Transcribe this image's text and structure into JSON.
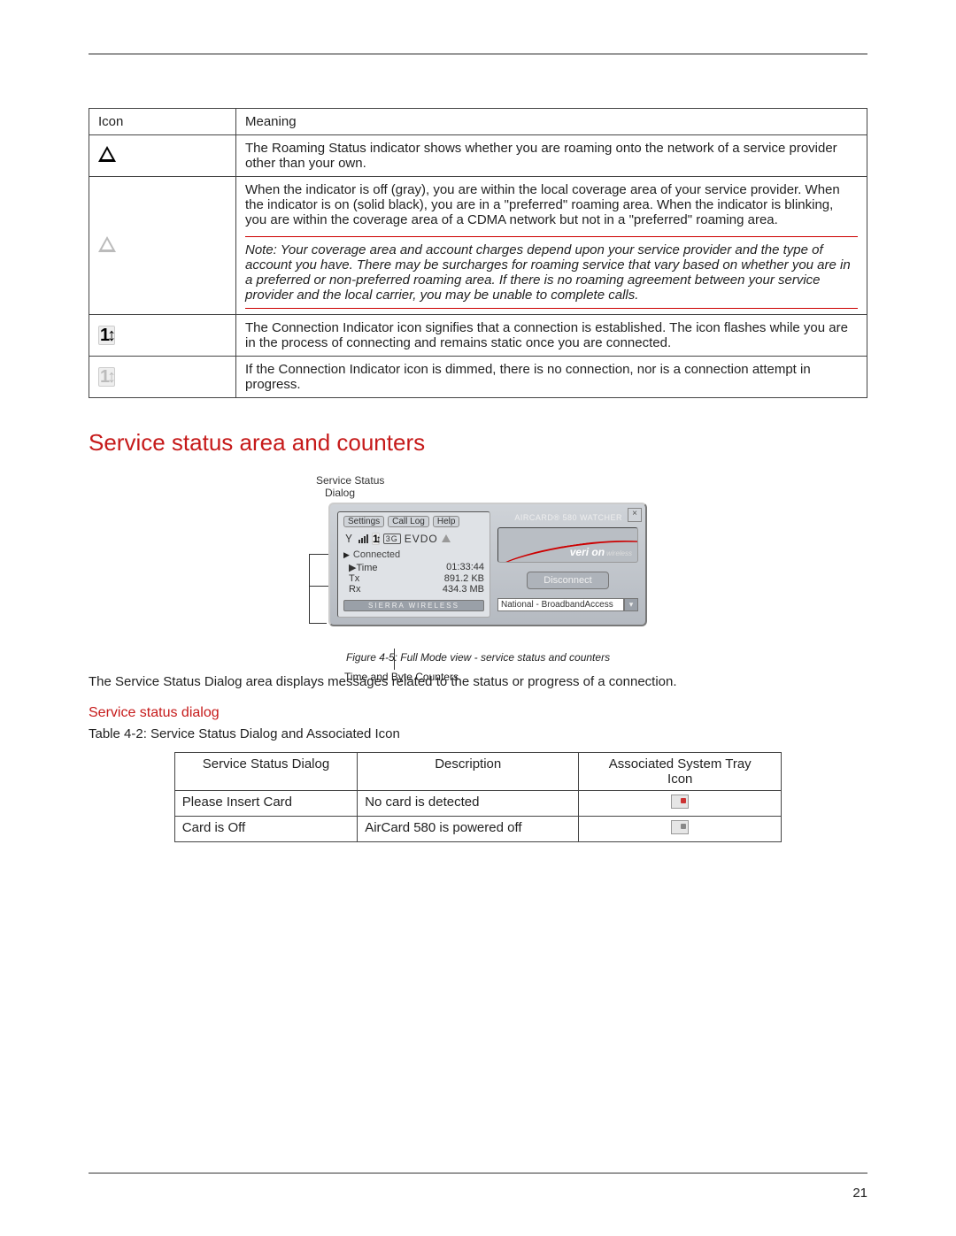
{
  "page_number": "21",
  "table1": {
    "headers": {
      "col1": "Icon",
      "col2": "Meaning"
    },
    "rows": [
      {
        "icon_name": "roaming-triangle-solid-icon",
        "meaning": "The Roaming Status indicator shows whether you are roaming onto the network of a service provider other than your own."
      },
      {
        "icon_name": "roaming-triangle-dim-icon",
        "meaning_p1": "When the indicator is off (gray), you are within the local coverage area of your service provider. When the indicator is on (solid black), you are in a \"preferred\" roaming area. When the indicator is blinking, you are within the coverage area of a CDMA network but not in a \"preferred\" roaming area.",
        "note": "Note: Your coverage area and account charges depend upon your service provider and the type of account you have. There may be surcharges for roaming service that vary based on whether you are in a preferred or non-preferred roaming area. If there is no roaming agreement between your service provider and the local carrier, you may be unable to complete calls."
      },
      {
        "icon_name": "connection-indicator-icon",
        "meaning": "The Connection Indicator icon signifies that a connection is established. The icon flashes while you are in the process of connecting and remains static once you are connected."
      },
      {
        "icon_name": "connection-indicator-dim-icon",
        "meaning": "If the Connection Indicator icon is dimmed, there is no connection, nor is a connection attempt in progress."
      }
    ]
  },
  "section_heading": "Service status area and counters",
  "figure": {
    "top_label_line1": "Service Status",
    "top_label_line2": "Dialog",
    "buttons": {
      "settings": "Settings",
      "calllog": "Call Log",
      "help": "Help"
    },
    "icons_line": {
      "threeg": "3G",
      "evdo": "EVDO"
    },
    "connected": "Connected",
    "stats": {
      "time_label": "Time",
      "time_val": "01:33:44",
      "tx_label": "Tx",
      "tx_val": "891.2 KB",
      "rx_label": "Rx",
      "rx_val": "434.3 MB"
    },
    "brand_bar": "SIERRA WIRELESS",
    "title_bar": "AIRCARD® 580 WATCHER",
    "logo_main": "veri on",
    "logo_sub": "wireless",
    "disconnect": "Disconnect",
    "national": "National - BroadbandAccess",
    "bottom_leader": "Time and Byte Counters",
    "caption": "Figure 4-5: Full Mode view - service status and counters"
  },
  "body_after_figure": "The Service Status Dialog area displays messages related to the status or progress of a connection.",
  "sub_heading": "Service status dialog",
  "table2_label": "Table 4-2: Service Status Dialog and Associated Icon",
  "table2": {
    "headers": {
      "c1": "Service Status Dialog",
      "c2": "Description",
      "c3_line1": "Associated System Tray",
      "c3_line2": "Icon"
    },
    "rows": [
      {
        "dialog": "Please Insert Card",
        "desc": "No card is detected",
        "icon": "tray-no-card-icon"
      },
      {
        "dialog": "Card is Off",
        "desc": "AirCard 580 is powered off",
        "icon": "tray-card-off-icon"
      }
    ]
  }
}
